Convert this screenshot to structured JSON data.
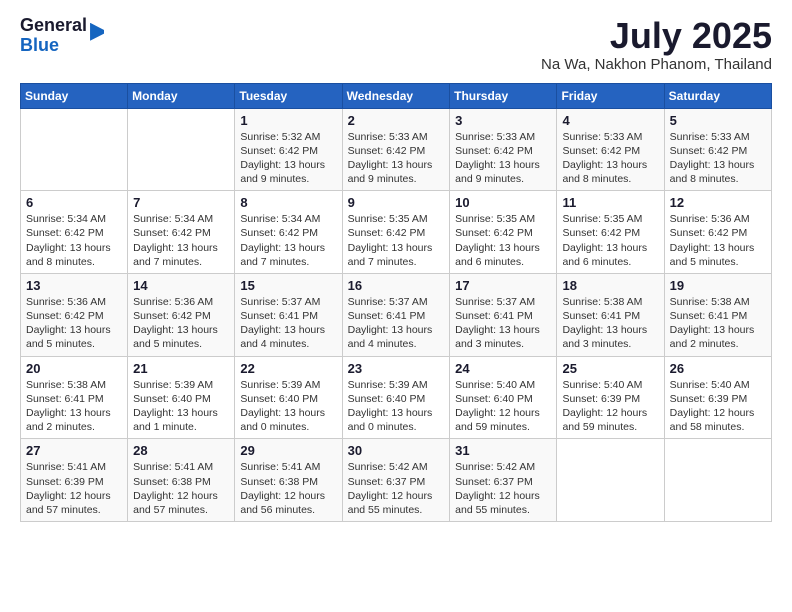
{
  "header": {
    "logo_general": "General",
    "logo_blue": "Blue",
    "main_title": "July 2025",
    "sub_title": "Na Wa, Nakhon Phanom, Thailand"
  },
  "calendar": {
    "days_of_week": [
      "Sunday",
      "Monday",
      "Tuesday",
      "Wednesday",
      "Thursday",
      "Friday",
      "Saturday"
    ],
    "weeks": [
      [
        {
          "num": "",
          "detail": ""
        },
        {
          "num": "",
          "detail": ""
        },
        {
          "num": "1",
          "detail": "Sunrise: 5:32 AM\nSunset: 6:42 PM\nDaylight: 13 hours and 9 minutes."
        },
        {
          "num": "2",
          "detail": "Sunrise: 5:33 AM\nSunset: 6:42 PM\nDaylight: 13 hours and 9 minutes."
        },
        {
          "num": "3",
          "detail": "Sunrise: 5:33 AM\nSunset: 6:42 PM\nDaylight: 13 hours and 9 minutes."
        },
        {
          "num": "4",
          "detail": "Sunrise: 5:33 AM\nSunset: 6:42 PM\nDaylight: 13 hours and 8 minutes."
        },
        {
          "num": "5",
          "detail": "Sunrise: 5:33 AM\nSunset: 6:42 PM\nDaylight: 13 hours and 8 minutes."
        }
      ],
      [
        {
          "num": "6",
          "detail": "Sunrise: 5:34 AM\nSunset: 6:42 PM\nDaylight: 13 hours and 8 minutes."
        },
        {
          "num": "7",
          "detail": "Sunrise: 5:34 AM\nSunset: 6:42 PM\nDaylight: 13 hours and 7 minutes."
        },
        {
          "num": "8",
          "detail": "Sunrise: 5:34 AM\nSunset: 6:42 PM\nDaylight: 13 hours and 7 minutes."
        },
        {
          "num": "9",
          "detail": "Sunrise: 5:35 AM\nSunset: 6:42 PM\nDaylight: 13 hours and 7 minutes."
        },
        {
          "num": "10",
          "detail": "Sunrise: 5:35 AM\nSunset: 6:42 PM\nDaylight: 13 hours and 6 minutes."
        },
        {
          "num": "11",
          "detail": "Sunrise: 5:35 AM\nSunset: 6:42 PM\nDaylight: 13 hours and 6 minutes."
        },
        {
          "num": "12",
          "detail": "Sunrise: 5:36 AM\nSunset: 6:42 PM\nDaylight: 13 hours and 5 minutes."
        }
      ],
      [
        {
          "num": "13",
          "detail": "Sunrise: 5:36 AM\nSunset: 6:42 PM\nDaylight: 13 hours and 5 minutes."
        },
        {
          "num": "14",
          "detail": "Sunrise: 5:36 AM\nSunset: 6:42 PM\nDaylight: 13 hours and 5 minutes."
        },
        {
          "num": "15",
          "detail": "Sunrise: 5:37 AM\nSunset: 6:41 PM\nDaylight: 13 hours and 4 minutes."
        },
        {
          "num": "16",
          "detail": "Sunrise: 5:37 AM\nSunset: 6:41 PM\nDaylight: 13 hours and 4 minutes."
        },
        {
          "num": "17",
          "detail": "Sunrise: 5:37 AM\nSunset: 6:41 PM\nDaylight: 13 hours and 3 minutes."
        },
        {
          "num": "18",
          "detail": "Sunrise: 5:38 AM\nSunset: 6:41 PM\nDaylight: 13 hours and 3 minutes."
        },
        {
          "num": "19",
          "detail": "Sunrise: 5:38 AM\nSunset: 6:41 PM\nDaylight: 13 hours and 2 minutes."
        }
      ],
      [
        {
          "num": "20",
          "detail": "Sunrise: 5:38 AM\nSunset: 6:41 PM\nDaylight: 13 hours and 2 minutes."
        },
        {
          "num": "21",
          "detail": "Sunrise: 5:39 AM\nSunset: 6:40 PM\nDaylight: 13 hours and 1 minute."
        },
        {
          "num": "22",
          "detail": "Sunrise: 5:39 AM\nSunset: 6:40 PM\nDaylight: 13 hours and 0 minutes."
        },
        {
          "num": "23",
          "detail": "Sunrise: 5:39 AM\nSunset: 6:40 PM\nDaylight: 13 hours and 0 minutes."
        },
        {
          "num": "24",
          "detail": "Sunrise: 5:40 AM\nSunset: 6:40 PM\nDaylight: 12 hours and 59 minutes."
        },
        {
          "num": "25",
          "detail": "Sunrise: 5:40 AM\nSunset: 6:39 PM\nDaylight: 12 hours and 59 minutes."
        },
        {
          "num": "26",
          "detail": "Sunrise: 5:40 AM\nSunset: 6:39 PM\nDaylight: 12 hours and 58 minutes."
        }
      ],
      [
        {
          "num": "27",
          "detail": "Sunrise: 5:41 AM\nSunset: 6:39 PM\nDaylight: 12 hours and 57 minutes."
        },
        {
          "num": "28",
          "detail": "Sunrise: 5:41 AM\nSunset: 6:38 PM\nDaylight: 12 hours and 57 minutes."
        },
        {
          "num": "29",
          "detail": "Sunrise: 5:41 AM\nSunset: 6:38 PM\nDaylight: 12 hours and 56 minutes."
        },
        {
          "num": "30",
          "detail": "Sunrise: 5:42 AM\nSunset: 6:37 PM\nDaylight: 12 hours and 55 minutes."
        },
        {
          "num": "31",
          "detail": "Sunrise: 5:42 AM\nSunset: 6:37 PM\nDaylight: 12 hours and 55 minutes."
        },
        {
          "num": "",
          "detail": ""
        },
        {
          "num": "",
          "detail": ""
        }
      ]
    ]
  }
}
